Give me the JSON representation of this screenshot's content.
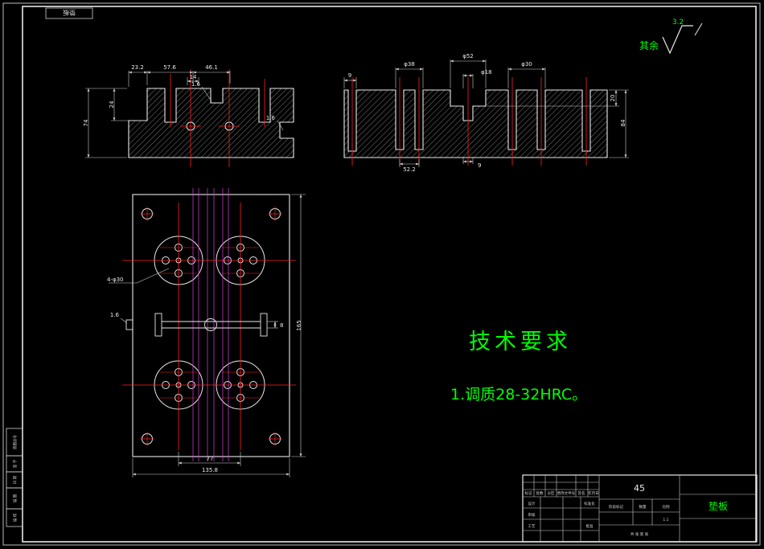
{
  "frame": {
    "corner_code": "垫板"
  },
  "margin_boxes": [
    "底图总号",
    "签 字",
    "日 期",
    "描 图",
    "描 校"
  ],
  "surface_note": {
    "prefix": "其余",
    "roughness": "3.2"
  },
  "tech_req": {
    "title": "技术要求",
    "item1": "1.调质28-32HRC。"
  },
  "views": {
    "section1": {
      "dims": [
        "23.2",
        "57.6",
        "46.1",
        "14",
        "1.6",
        "1.6",
        "74",
        "24"
      ]
    },
    "section2": {
      "dims": [
        "φ38",
        "φ52",
        "φ18",
        "φ30",
        "9",
        "20",
        "84",
        "52.2",
        "9"
      ]
    },
    "plan": {
      "dims": [
        "4-φ30",
        "8",
        "1.6",
        "77",
        "135.8",
        "165"
      ]
    }
  },
  "title_block": {
    "material": "45",
    "part_name": "垫板",
    "stage_label": "阶段标记",
    "qty_label": "数量",
    "scale_label": "比例",
    "scale_value": "1:1",
    "sheets": "共 张  第 张",
    "rev0": "标记",
    "rev1": "处数",
    "rev2": "分区",
    "rev3": "更改文件号",
    "rev4": "签名",
    "rev5": "年月日",
    "design": "设计",
    "standardization": "标准化",
    "audit": "审核",
    "craft": "工艺",
    "approve": "批准"
  }
}
